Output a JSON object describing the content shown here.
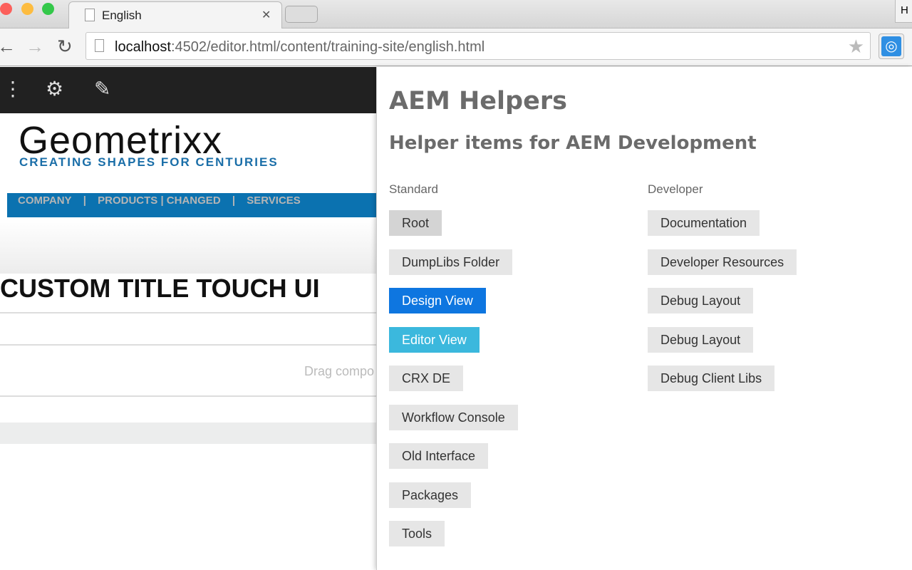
{
  "browser": {
    "tab_title": "English",
    "url_host": "localhost",
    "url_path": ":4502/editor.html/content/training-site/english.html",
    "profile_initial": "H",
    "colors": {
      "close": "#fc605b",
      "minimize": "#fdbc40",
      "maximize": "#34c84a",
      "extension": "#2f8fe3"
    }
  },
  "page": {
    "logo": "Geometrixx",
    "slogan": "CREATING SHAPES FOR CENTURIES",
    "menu": [
      "COMPANY",
      "|",
      "PRODUCTS | CHANGED",
      "|",
      "SERVICES"
    ],
    "heading": "CUSTOM TITLE TOUCH UI",
    "drag_hint": "Drag compo"
  },
  "popup": {
    "title": "AEM Helpers",
    "subtitle": "Helper items for AEM Development",
    "standard": {
      "label": "Standard",
      "items": [
        "Root",
        "DumpLibs Folder",
        "Design View",
        "Editor View",
        "CRX DE",
        "Workflow Console",
        "Old Interface",
        "Packages",
        "Tools"
      ]
    },
    "developer": {
      "label": "Developer",
      "items": [
        "Documentation",
        "Developer Resources",
        "Debug Layout",
        "Debug Layout",
        "Debug Client Libs"
      ]
    }
  }
}
